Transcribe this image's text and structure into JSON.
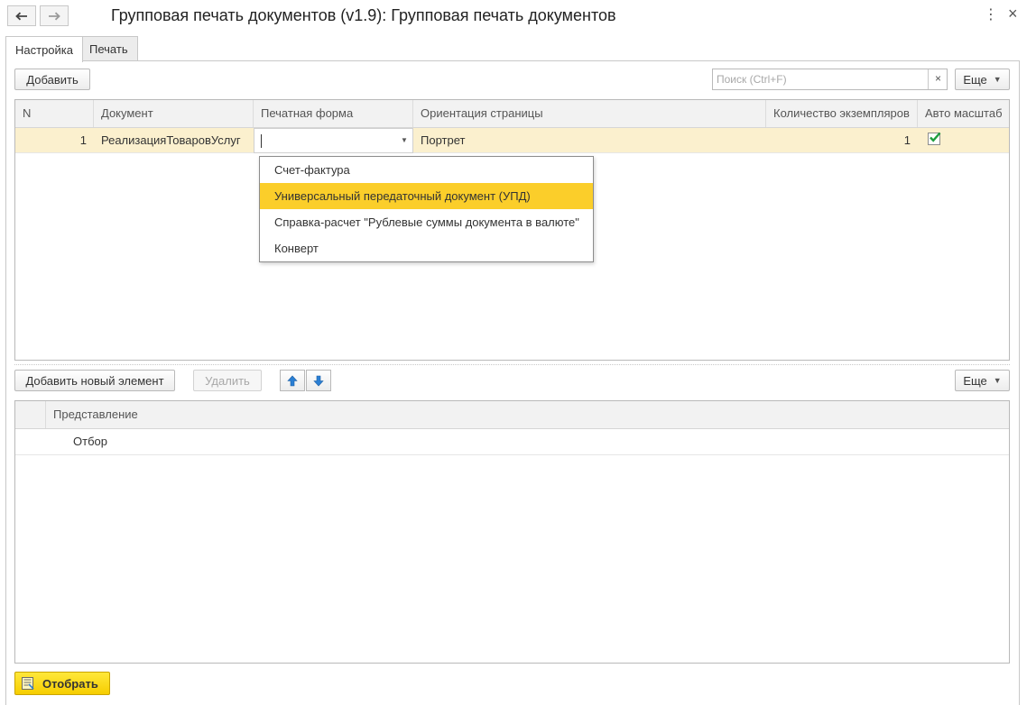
{
  "window": {
    "title": "Групповая печать документов (v1.9): Групповая печать документов",
    "more_icon": "⋮",
    "close_icon": "×"
  },
  "tabs": [
    {
      "label": "Настройка",
      "active": true
    },
    {
      "label": "Печать",
      "active": false
    }
  ],
  "toolbar": {
    "add_label": "Добавить",
    "search_placeholder": "Поиск (Ctrl+F)",
    "search_clear": "×",
    "more_label": "Еще"
  },
  "documents_table": {
    "columns": [
      "N",
      "Документ",
      "Печатная форма",
      "Ориентация страницы",
      "Количество экземпляров",
      "Авто масштаб"
    ],
    "rows": [
      {
        "n": "1",
        "document": "РеализацияТоваровУслуг",
        "print_form": "",
        "orientation": "Портрет",
        "copies": "1",
        "auto_scale": true
      }
    ]
  },
  "print_form_dropdown": {
    "options": [
      "Счет-фактура",
      "Универсальный передаточный документ (УПД)",
      "Справка-расчет \"Рублевые суммы документа в валюте\"",
      "Конверт"
    ],
    "selected_index": 1
  },
  "filter_toolbar": {
    "add_new_label": "Добавить новый элемент",
    "delete_label": "Удалить",
    "more_label": "Еще"
  },
  "filter_table": {
    "columns": [
      "Представление"
    ],
    "rows": [
      {
        "label": "Отбор"
      }
    ]
  },
  "footer": {
    "select_label": "Отобрать"
  },
  "colors": {
    "selected_row": "#fbf0ce",
    "highlight": "#fbce2a",
    "primary_button": "#f6cd00",
    "checkbox_check": "#1e9e3e",
    "arrow_icon": "#2a7fd4"
  }
}
